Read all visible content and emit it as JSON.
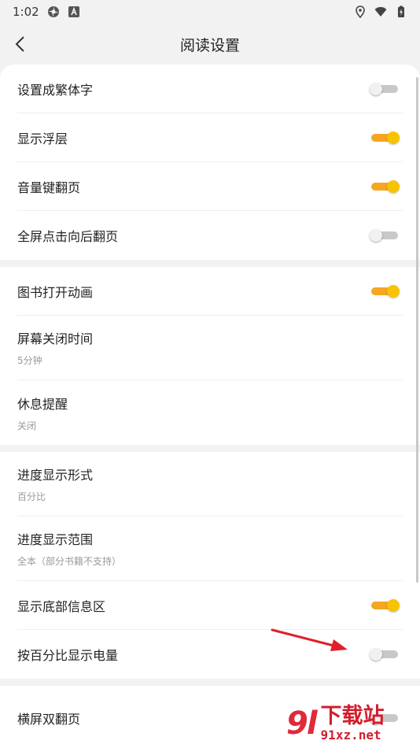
{
  "status_bar": {
    "time": "1:02",
    "icons": [
      "settings-app-icon",
      "a-notification-icon",
      "location-icon",
      "wifi-icon",
      "battery-icon"
    ]
  },
  "header": {
    "title": "阅读设置",
    "back_icon": "chevron-left-icon"
  },
  "groups": [
    {
      "items": [
        {
          "label": "设置成繁体字",
          "type": "toggle",
          "on": false
        },
        {
          "label": "显示浮层",
          "type": "toggle",
          "on": true
        },
        {
          "label": "音量键翻页",
          "type": "toggle",
          "on": true
        },
        {
          "label": "全屏点击向后翻页",
          "type": "toggle",
          "on": false
        }
      ]
    },
    {
      "items": [
        {
          "label": "图书打开动画",
          "type": "toggle",
          "on": true
        },
        {
          "label": "屏幕关闭时间",
          "type": "value",
          "value": "5分钟"
        },
        {
          "label": "休息提醒",
          "type": "value",
          "value": "关闭"
        }
      ]
    },
    {
      "items": [
        {
          "label": "进度显示形式",
          "type": "value",
          "value": "百分比"
        },
        {
          "label": "进度显示范围",
          "type": "value",
          "value": "全本（部分书籍不支持）"
        },
        {
          "label": "显示底部信息区",
          "type": "toggle",
          "on": true
        },
        {
          "label": "按百分比显示电量",
          "type": "toggle",
          "on": false
        }
      ]
    },
    {
      "items": [
        {
          "label": "横屏双翻页",
          "type": "toggle",
          "on": false
        }
      ]
    }
  ],
  "colors": {
    "toggle_on_track": "#f5a623",
    "toggle_on_knob": "#f7c300",
    "toggle_off_track": "#c8c8c8",
    "annotation_arrow": "#e0202a",
    "watermark": "#d11e2d"
  },
  "watermark": {
    "logo": "9l",
    "text": "下载站",
    "url": "91xz.net"
  }
}
